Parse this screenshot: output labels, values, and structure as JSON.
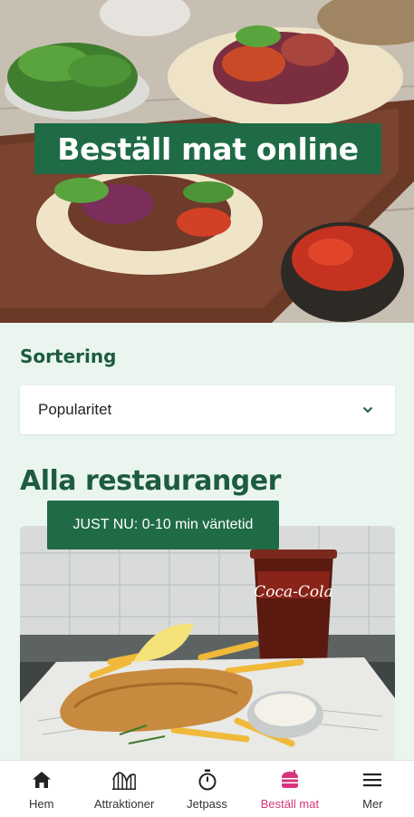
{
  "hero": {
    "title": "Beställ mat online"
  },
  "sort": {
    "label": "Sortering",
    "selected": "Popularitet"
  },
  "section": {
    "title": "Alla restauranger"
  },
  "restaurant_card": {
    "badge": "JUST NU: 0-10 min väntetid",
    "cup_brand": "Coca-Cola"
  },
  "nav": {
    "items": [
      {
        "label": "Hem",
        "icon": "home-icon"
      },
      {
        "label": "Attraktioner",
        "icon": "rollercoaster-icon"
      },
      {
        "label": "Jetpass",
        "icon": "stopwatch-icon"
      },
      {
        "label": "Beställ mat",
        "icon": "food-order-icon",
        "active": true
      },
      {
        "label": "Mer",
        "icon": "menu-icon"
      }
    ]
  },
  "colors": {
    "brand_green": "#1f6b45",
    "heading_green": "#1d5c3e",
    "active_pink": "#d6357a",
    "background": "#eaf5f0"
  }
}
